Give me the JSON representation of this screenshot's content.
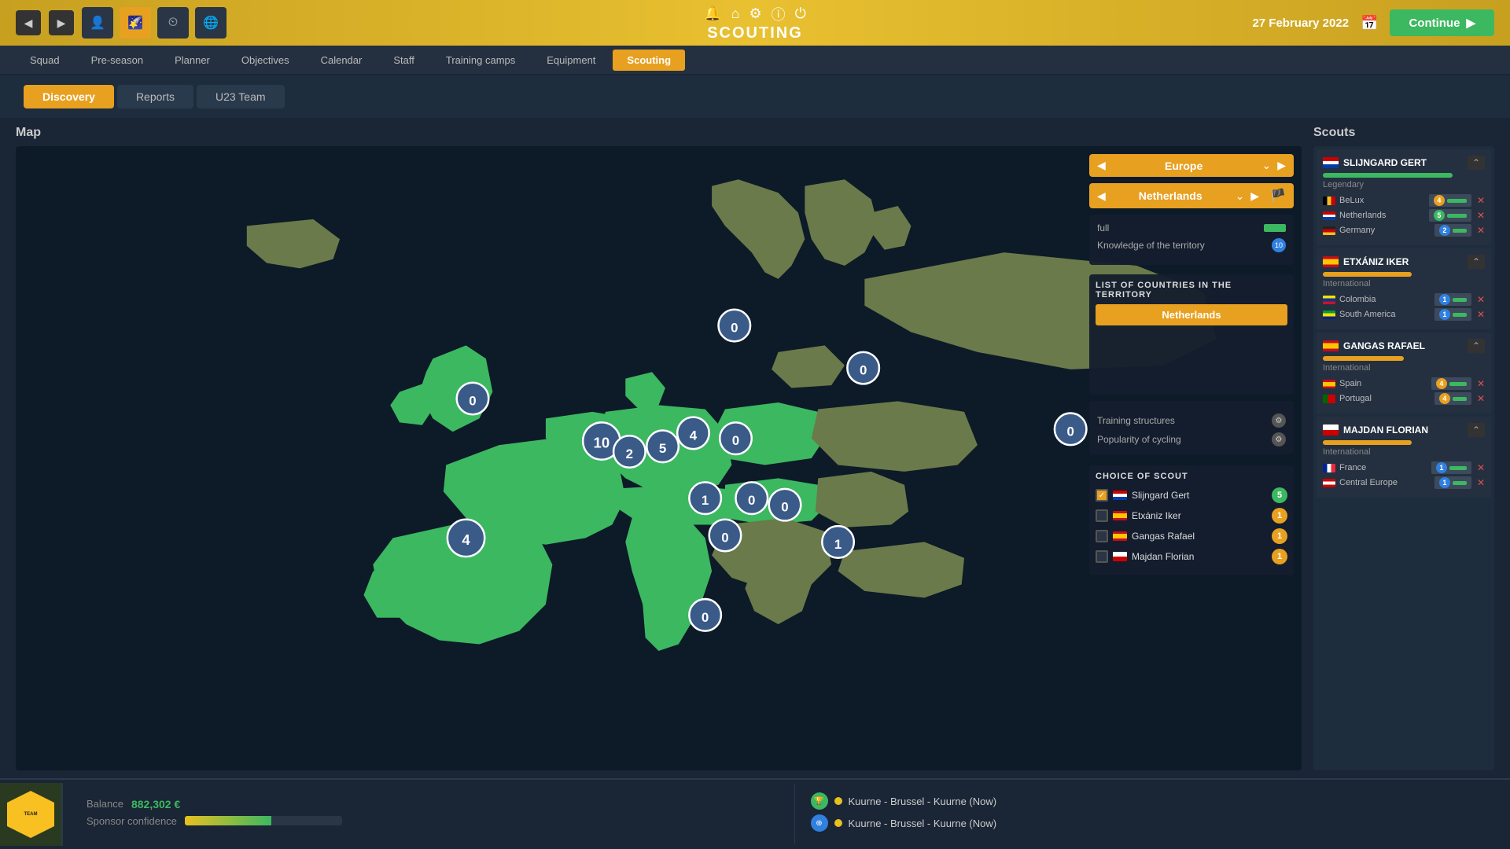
{
  "topBar": {
    "title": "SCOUTING",
    "date": "27 February 2022",
    "continueLabel": "Continue"
  },
  "navItems": [
    {
      "label": "Squad",
      "active": false
    },
    {
      "label": "Pre-season",
      "active": false
    },
    {
      "label": "Planner",
      "active": false
    },
    {
      "label": "Objectives",
      "active": false
    },
    {
      "label": "Calendar",
      "active": false
    },
    {
      "label": "Staff",
      "active": false
    },
    {
      "label": "Training camps",
      "active": false
    },
    {
      "label": "Equipment",
      "active": false
    },
    {
      "label": "Scouting",
      "active": true
    }
  ],
  "subTabs": [
    {
      "label": "Discovery",
      "active": true
    },
    {
      "label": "Reports",
      "active": false
    },
    {
      "label": "U23 Team",
      "active": false
    }
  ],
  "mapSection": {
    "label": "Map",
    "regionSelector": "Europe",
    "countrySelector": "Netherlands",
    "workBarValue": "full",
    "knowledgeValue": "full",
    "listTitle": "LIST OF COUNTRIES IN THE TERRITORY",
    "selectedCountry": "Netherlands",
    "trainingStructures": "Training structures",
    "popularityCycling": "Popularity of cycling",
    "choiceOfScout": "CHOICE OF SCOUT",
    "scouts": [
      {
        "name": "Slijngard Gert",
        "flag": "nl",
        "num": 5,
        "checked": true
      },
      {
        "name": "Etxániz Iker",
        "flag": "es",
        "num": 1,
        "checked": false
      },
      {
        "name": "Gangas Rafael",
        "flag": "es",
        "num": 1,
        "checked": false
      },
      {
        "name": "Majdan Florian",
        "flag": "pl",
        "num": 1,
        "checked": false
      }
    ]
  },
  "scoutsPanel": {
    "title": "Scouts",
    "scouts": [
      {
        "name": "SLIJNGARD GERT",
        "flag": "nl",
        "tier": "Legendary",
        "qualityWidth": "80",
        "regions": [
          {
            "name": "BeLux",
            "flag": "be",
            "num": 4,
            "hasX": true
          },
          {
            "name": "Netherlands",
            "flag": "nl",
            "num": 5,
            "hasX": true
          },
          {
            "name": "Germany",
            "flag": "de",
            "num": 2,
            "hasX": true
          }
        ]
      },
      {
        "name": "ETXÁNIZ IKER",
        "flag": "es",
        "tier": "International",
        "qualityWidth": "55",
        "regions": [
          {
            "name": "Colombia",
            "flag": "co",
            "num": 1,
            "hasX": true
          },
          {
            "name": "South America",
            "flag": "br",
            "num": 1,
            "hasX": true
          }
        ]
      },
      {
        "name": "GANGAS RAFAEL",
        "flag": "es",
        "tier": "International",
        "qualityWidth": "50",
        "regions": [
          {
            "name": "Spain",
            "flag": "es",
            "num": 4,
            "hasX": true
          },
          {
            "name": "Portugal",
            "flag": "pt",
            "num": 4,
            "hasX": true
          }
        ]
      },
      {
        "name": "MAJDAN FLORIAN",
        "flag": "pl",
        "tier": "International",
        "qualityWidth": "55",
        "regions": [
          {
            "name": "France",
            "flag": "fr",
            "num": 1,
            "hasX": true
          },
          {
            "name": "Central Europe",
            "flag": "at",
            "num": 1,
            "hasX": true
          }
        ]
      }
    ]
  },
  "bottomBar": {
    "balanceLabel": "Balance",
    "balanceValue": "882,302 €",
    "sponsorLabel": "Sponsor confidence",
    "events": [
      {
        "text": "Kuurne - Brussel - Kuurne (Now)"
      },
      {
        "text": "Kuurne - Brussel - Kuurne (Now)"
      }
    ]
  }
}
